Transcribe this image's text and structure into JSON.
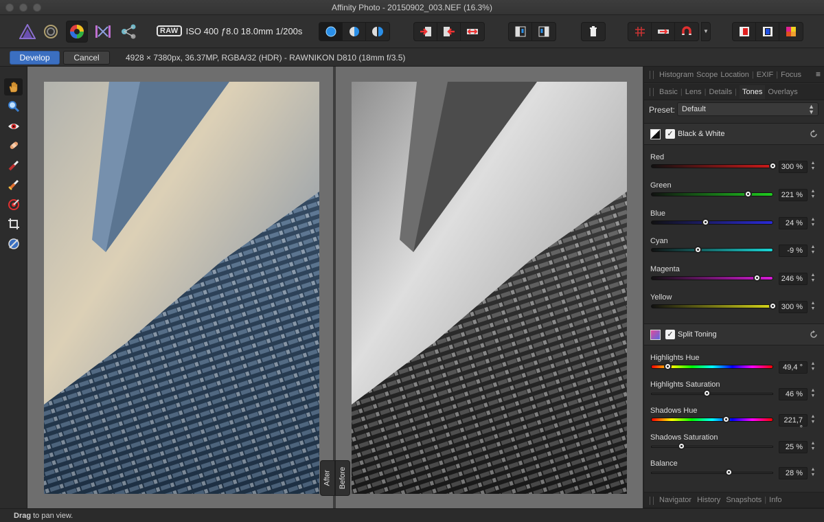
{
  "window": {
    "title": "Affinity Photo - 20150902_003.NEF (16.3%)"
  },
  "toolbar": {
    "personas": [
      "photo-persona-icon",
      "liquify-persona-icon",
      "develop-persona-icon",
      "tone-mapping-persona-icon",
      "export-persona-icon"
    ],
    "raw_badge": "RAW",
    "exif": "ISO 400 ƒ8.0 18.0mm 1/200s"
  },
  "context": {
    "develop_label": "Develop",
    "cancel_label": "Cancel",
    "doc_info": "4928 × 7380px, 36.37MP, RGBA/32 (HDR) - RAW",
    "camera_info": "NIKON D810 (18mm f/3.5)"
  },
  "canvas": {
    "after_label": "After",
    "before_label": "Before"
  },
  "status": {
    "bold": "Drag",
    "text": " to pan view."
  },
  "panel": {
    "top_tabs": [
      "Histogram",
      "Scope",
      "Location",
      "EXIF",
      "Focus"
    ],
    "sub_tabs": [
      "Basic",
      "Lens",
      "Details",
      "Tones",
      "Overlays"
    ],
    "active_sub_tab": "Tones",
    "bottom_tabs": [
      "Navigator",
      "History",
      "Snapshots",
      "Info"
    ],
    "preset_label": "Preset:",
    "preset_value": "Default",
    "bw": {
      "title": "Black & White",
      "enabled": true,
      "sliders": [
        {
          "label": "Red",
          "value": "300 %",
          "fraction": 1.0,
          "color": "#cc1a1a"
        },
        {
          "label": "Green",
          "value": "221 %",
          "fraction": 0.8,
          "color": "#1fcc1f"
        },
        {
          "label": "Blue",
          "value": "24 %",
          "fraction": 0.45,
          "color": "#2a2ad6"
        },
        {
          "label": "Cyan",
          "value": "-9 %",
          "fraction": 0.39,
          "color": "#1ad6d6"
        },
        {
          "label": "Magenta",
          "value": "246 %",
          "fraction": 0.87,
          "color": "#d61ad6"
        },
        {
          "label": "Yellow",
          "value": "300 %",
          "fraction": 1.0,
          "color": "#d6d61a"
        }
      ]
    },
    "split": {
      "title": "Split Toning",
      "enabled": true,
      "sliders": [
        {
          "label": "Highlights Hue",
          "value": "49,4 °",
          "fraction": 0.14,
          "kind": "hue"
        },
        {
          "label": "Highlights Saturation",
          "value": "46 %",
          "fraction": 0.46,
          "kind": "plain"
        },
        {
          "label": "Shadows Hue",
          "value": "221,7 °",
          "fraction": 0.62,
          "kind": "hue"
        },
        {
          "label": "Shadows Saturation",
          "value": "25 %",
          "fraction": 0.25,
          "kind": "plain"
        },
        {
          "label": "Balance",
          "value": "28 %",
          "fraction": 0.64,
          "kind": "plain"
        }
      ]
    }
  }
}
